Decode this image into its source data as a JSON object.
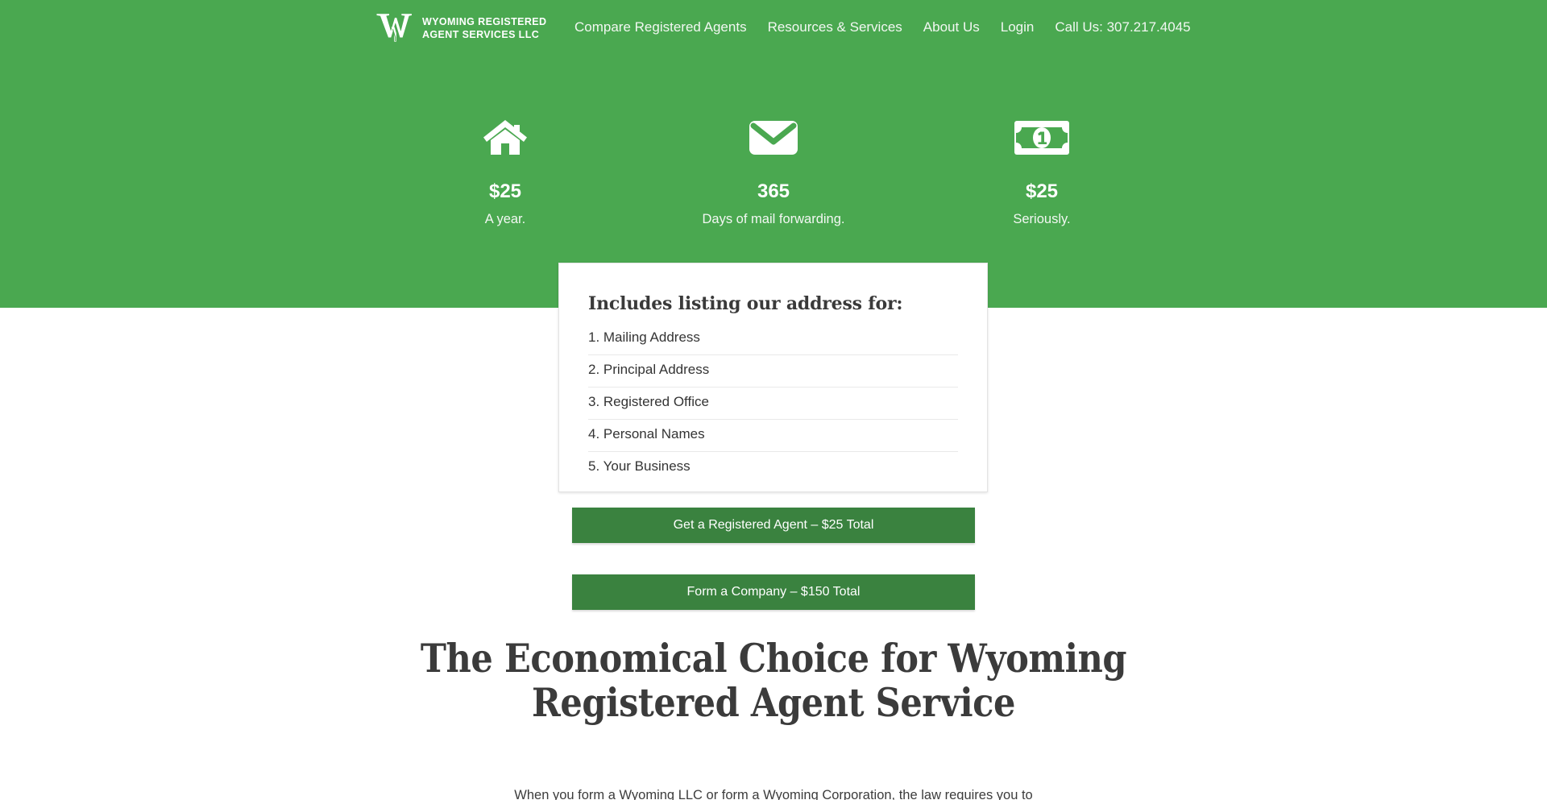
{
  "header": {
    "brand": {
      "logo_icon": "w-monogram-logo",
      "name_line1": "WYOMING REGISTERED",
      "name_line2": "AGENT SERVICES LLC",
      "name_full": "WYOMING REGISTERED\nAGENT SERVICES LLC"
    },
    "nav": [
      {
        "label": "Compare Registered Agents",
        "name": "nav-compare-registered-agents"
      },
      {
        "label": "Resources & Services",
        "name": "nav-resources-services"
      },
      {
        "label": "About Us",
        "name": "nav-about-us"
      },
      {
        "label": "Login",
        "name": "nav-login"
      },
      {
        "label": "Call Us: 307.217.4045",
        "name": "nav-call-us"
      }
    ]
  },
  "hero": {
    "background_color": "#4aa850",
    "features": [
      {
        "icon": "home-icon",
        "value": "$25",
        "caption": "A year."
      },
      {
        "icon": "envelope-icon",
        "value": "365",
        "caption": "Days of mail forwarding."
      },
      {
        "icon": "money-bill-icon",
        "value": "$25",
        "caption": "Seriously."
      }
    ]
  },
  "card": {
    "title": "Includes listing our address for:",
    "items": [
      "1. Mailing Address",
      "2. Principal Address",
      "3. Registered Office",
      "4. Personal Names",
      "5. Your Business"
    ]
  },
  "cta": {
    "button_color": "#3a823f",
    "primary_label": "Get a Registered Agent – $25 Total",
    "secondary_label": "Form a Company – $150 Total"
  },
  "main": {
    "headline": "The Economical Choice for Wyoming Registered Agent Service",
    "lede": "When you form a Wyoming LLC or form a Wyoming Corporation, the law requires you to"
  }
}
